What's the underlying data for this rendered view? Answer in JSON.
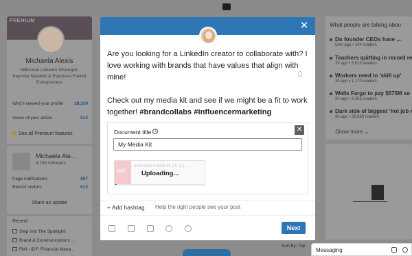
{
  "profile": {
    "banner_label": "PREMIUM",
    "name": "Michaela Alexis",
    "headline": "Millennial LinkedIn Strategist, Keynote Speaker & Espresso-Fueled Entrepreneur",
    "stats": [
      {
        "label": "Who's viewed your profile",
        "value": "28,339"
      },
      {
        "label": "Views of your article",
        "value": "512"
      }
    ],
    "premium_features": "See all Premium features"
  },
  "page_card": {
    "name": "Michaela Ale...",
    "followers": "4,744 followers",
    "stats": [
      {
        "label": "Page notifications",
        "value": "507"
      },
      {
        "label": "Recent visitors",
        "value": "613"
      }
    ],
    "share": "Share an update"
  },
  "recent": {
    "title": "Recent",
    "items": [
      "Step Into The Spotlight!",
      "Brand & Communications ...",
      "FMI - IDF: Financial Mana..."
    ]
  },
  "news": {
    "title": "What people are talking abou",
    "items": [
      {
        "headline": "Do founder CEOs have ...",
        "meta": "58m ago • 144 readers"
      },
      {
        "headline": "Teachers quitting in record re",
        "meta": "2h ago • 3,613 readers"
      },
      {
        "headline": "Workers need to 'skill up'",
        "meta": "3h ago • 1,170 readers"
      },
      {
        "headline": "Wells Fargo to pay $575M se",
        "meta": "2h ago • 4,255 readers"
      },
      {
        "headline": "Dark side of biggest 'hot job re",
        "meta": "3h ago • 25,669 readers"
      }
    ],
    "show_more": "Show more"
  },
  "sort_by": "Sort by: Top",
  "messaging": {
    "label": "Messaging"
  },
  "modal": {
    "post_paragraph_1": "Are you looking for a LinkedIn creator to collaborate with? I love working with brands that have values that align with mine!",
    "post_paragraph_2_text": "Check out my media kit and see if we might be a fit to work together! ",
    "post_paragraph_2_tags": "#brandcollabs #influencermarketing",
    "document_title_label": "Document title",
    "document_title_value": "My Media Kit",
    "file_thumb_label": "PDF",
    "file_name": "michaela media kit (4) (1)...",
    "upload_status": "Uploading...",
    "upload_progress": 0.02,
    "add_hashtag": "+ Add hashtag",
    "hashtag_hint": "Help the right people see your post",
    "next_button": "Next",
    "close_symbol": "✕",
    "remove_symbol": "✕"
  },
  "colors": {
    "accent": "#2e76b6"
  }
}
